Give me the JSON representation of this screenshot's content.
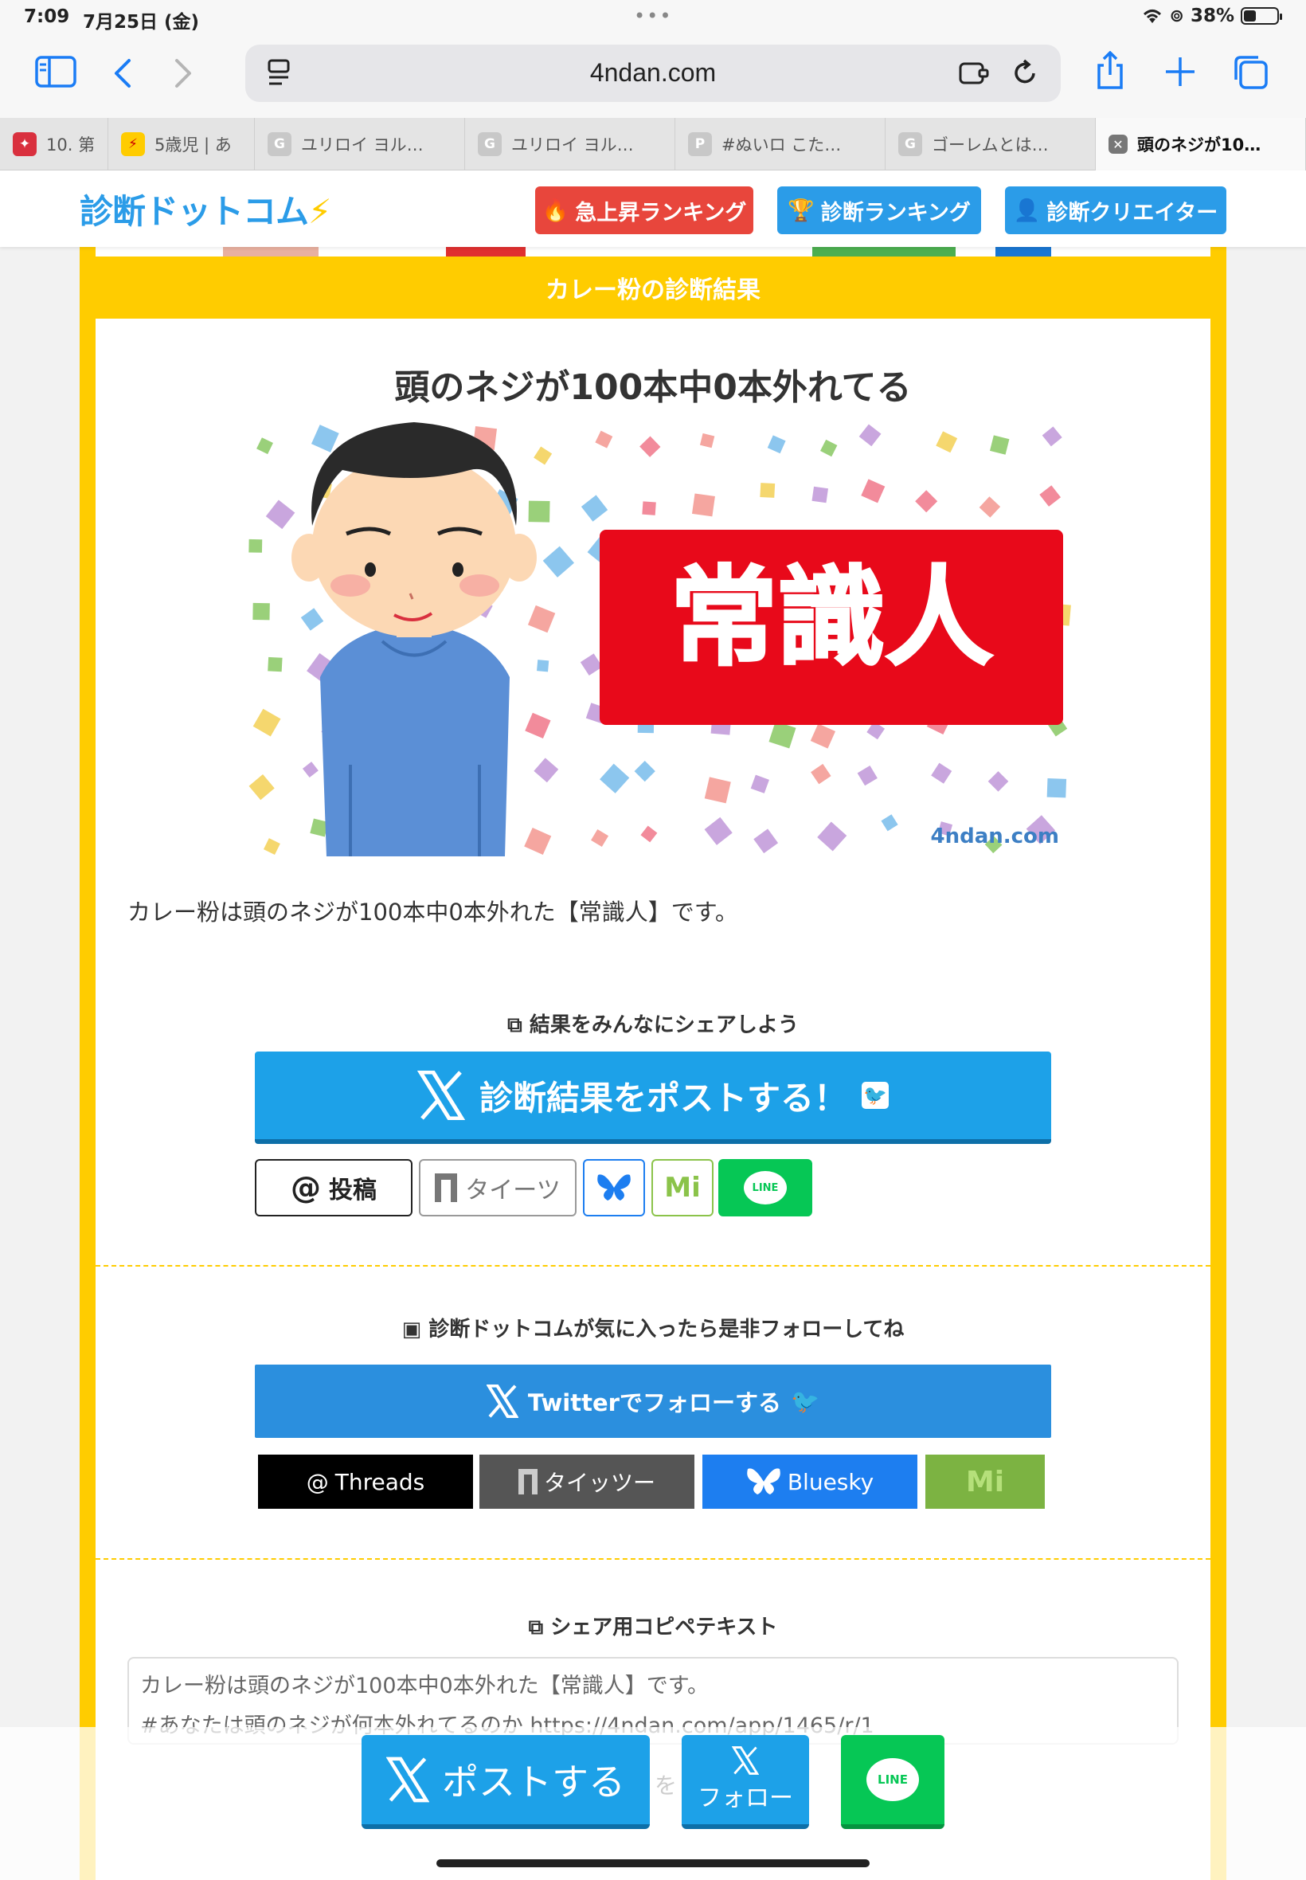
{
  "status_bar": {
    "time": "7:09",
    "date": "7月25日 (金)",
    "battery": "38%",
    "battery_level": 0.38
  },
  "browser": {
    "url": "4ndan.com",
    "tabs": [
      {
        "title": "10. 第",
        "favicon": "bookmark-icon"
      },
      {
        "title": "5歳児 | あ",
        "favicon": "bolt-icon"
      },
      {
        "title": "ユリロイ ヨル…",
        "favicon": "G"
      },
      {
        "title": "ユリロイ ヨル…",
        "favicon": "G"
      },
      {
        "title": "#ぬいロ こた…",
        "favicon": "P"
      },
      {
        "title": "ゴーレムとは…",
        "favicon": "G"
      },
      {
        "title": "頭のネジが10…",
        "favicon": "close-icon"
      }
    ]
  },
  "site": {
    "logo": "診断ドットコム",
    "nav": [
      {
        "label": "急上昇ランキング",
        "icon": "flame-icon",
        "color": "#e8463c"
      },
      {
        "label": "診断ランキング",
        "icon": "trophy-icon",
        "color": "#2b9ce8"
      },
      {
        "label": "診断クリエイター",
        "icon": "user-icon",
        "color": "#2b9ce8"
      }
    ]
  },
  "result": {
    "heading": "カレー粉の診断結果",
    "title": "頭のネジが100本中0本外れてる",
    "image_badge": "常識人",
    "image_watermark": "4ndan.com",
    "text": "カレー粉は頭のネジが100本中0本外れた【常識人】です。"
  },
  "share": {
    "label": "結果をみんなにシェアしよう",
    "post_button": "診断結果をポストする！",
    "threads_label": "投稿",
    "taittsu_label": "タイーツ",
    "misskey_label": "Mi",
    "line_label": "LINE"
  },
  "follow": {
    "label": "診断ドットコムが気に入ったら是非フォローしてね",
    "twitter_button": "Twitterでフォローする",
    "threads": "Threads",
    "taittsu": "タイッツー",
    "bluesky": "Bluesky",
    "misskey": "Mi"
  },
  "copy": {
    "label": "シェア用コピペテキスト",
    "line1": "カレー粉は頭のネジが100本中0本外れた【常識人】です。",
    "line2": "#あなたは頭のネジが何本外れてるのか https://4ndan.com/app/1465/r/1"
  },
  "floating": {
    "post": "ポストする",
    "follow": "フォロー",
    "line": "LINE",
    "hidden_char": "を"
  }
}
